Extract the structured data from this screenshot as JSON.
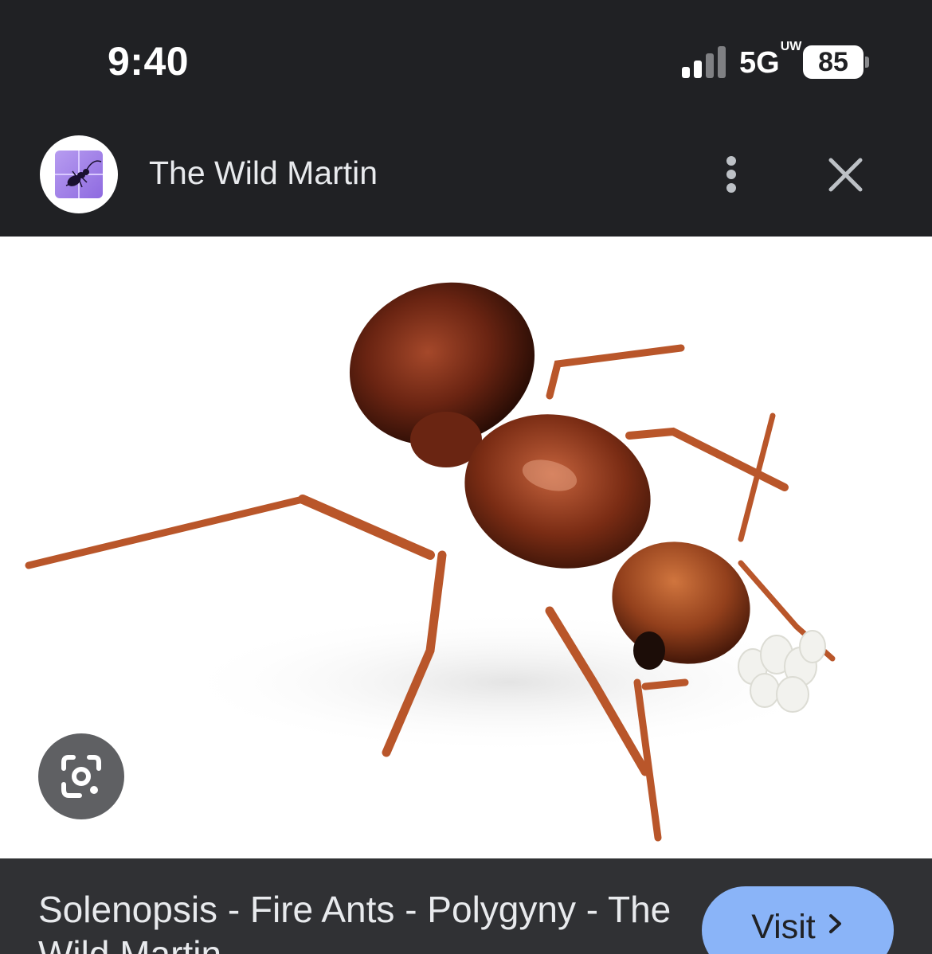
{
  "status_bar": {
    "time": "9:40",
    "network": "5G",
    "network_badge": "UW",
    "battery": "85"
  },
  "header": {
    "site_name": "The Wild Martin",
    "avatar_icon": "ant-logo-icon",
    "more_icon": "more-vert-icon",
    "close_icon": "close-icon"
  },
  "image": {
    "subject": "fire ant carrying eggs"
  },
  "lens": {
    "icon": "google-lens-icon"
  },
  "footer": {
    "caption": "Solenopsis - Fire Ants - Polygyny - The Wild Martin",
    "visit_label": "Visit",
    "visit_icon": "chevron-right-icon"
  },
  "colors": {
    "background": "#202124",
    "footer": "#303134",
    "accent": "#8ab4f8"
  }
}
